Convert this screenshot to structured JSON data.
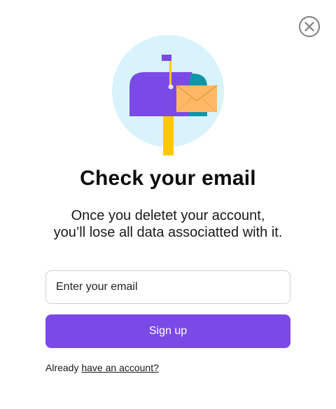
{
  "dialog": {
    "close_icon": "close-circle-icon",
    "illustration_icon": "mailbox-icon",
    "title": "Check your email",
    "subtitle_line1": "Once you deletet your account,",
    "subtitle_line2": "you’ll lose all data associatted with it.",
    "email_placeholder": "Enter your email",
    "email_value": "",
    "signup_label": "Sign up",
    "footer_text": "Already ",
    "footer_link": "have an account?"
  },
  "colors": {
    "accent": "#7b4ae6",
    "mailbox_purple": "#7b4ae6",
    "circle_bg": "#d8f3fb",
    "post_yellow": "#ffc800",
    "envelope_orange": "#ffb866",
    "teal": "#0f96a8"
  }
}
